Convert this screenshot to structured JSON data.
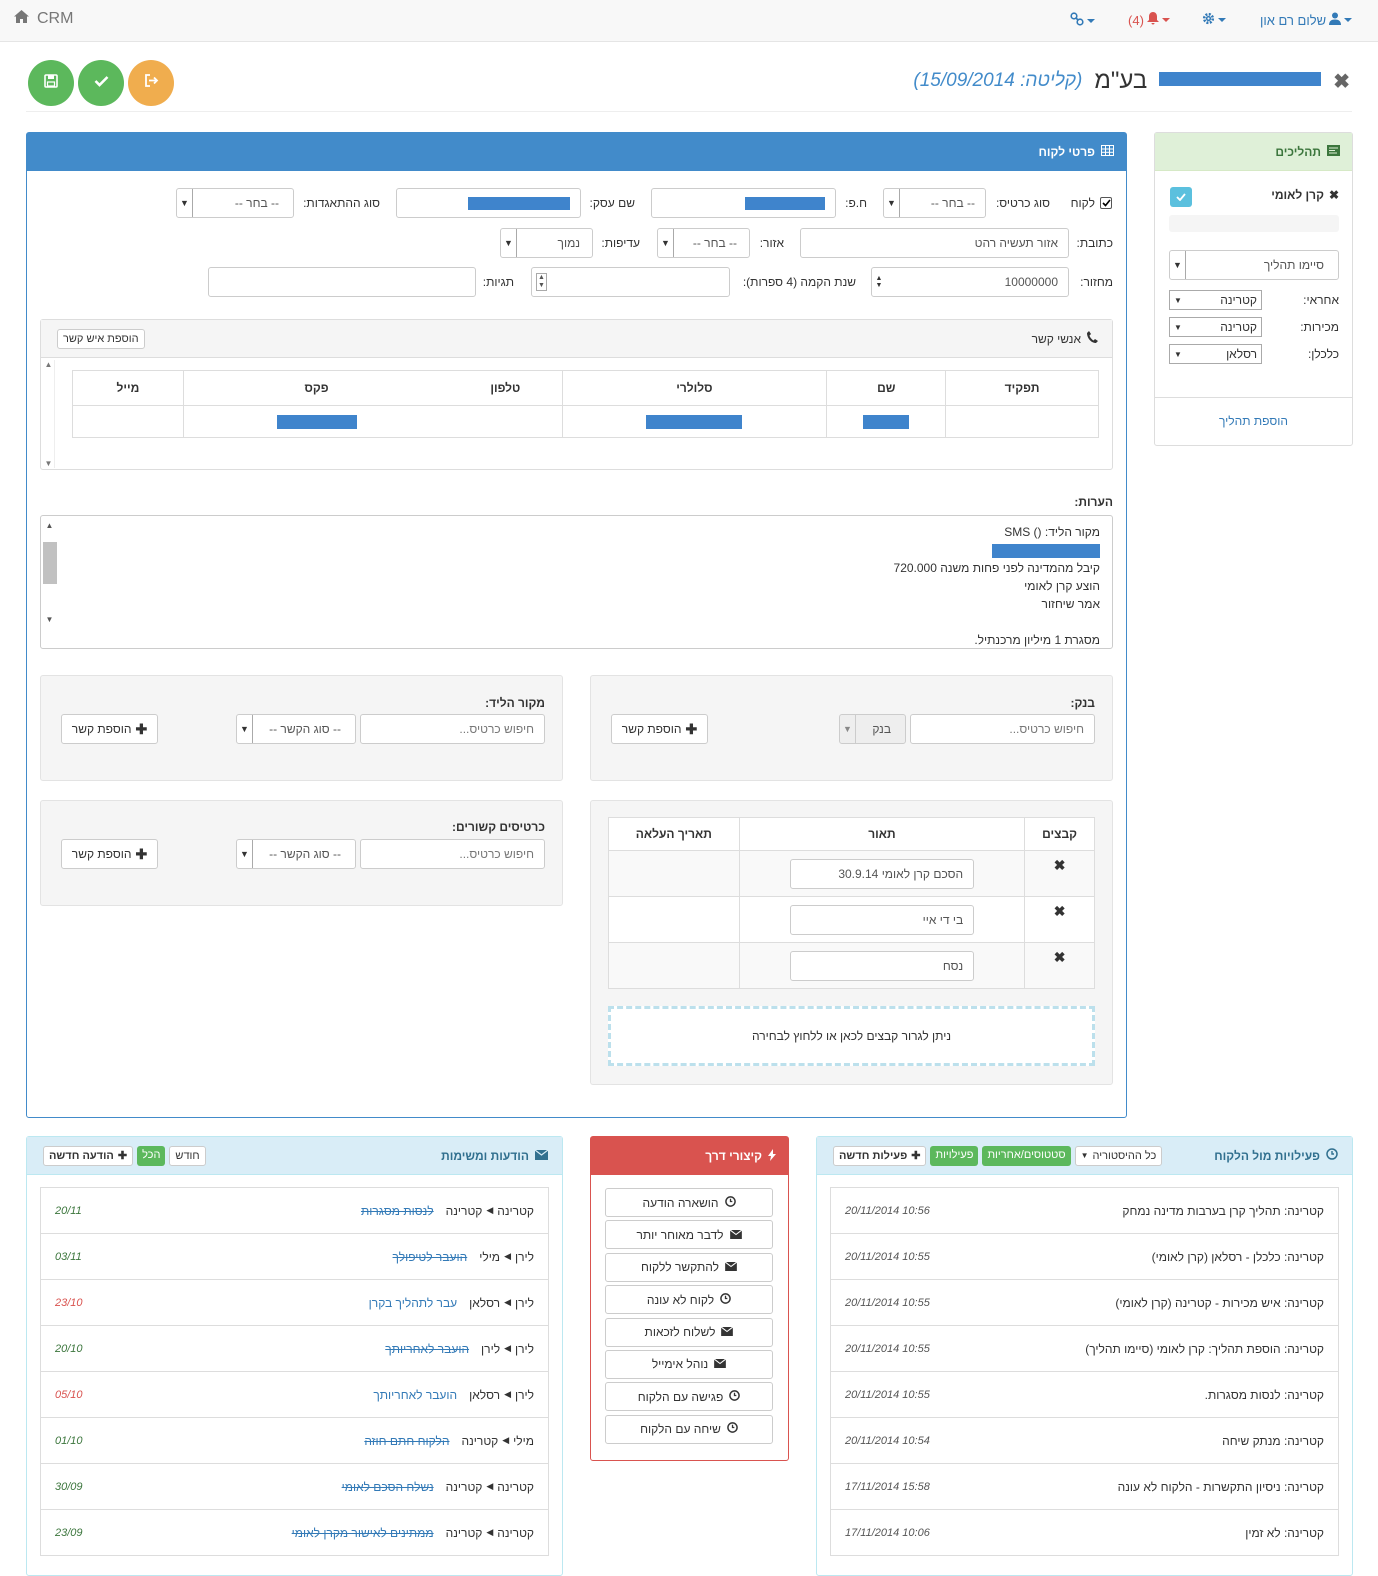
{
  "nav": {
    "brand": "CRM",
    "user": "שלום רם און",
    "alerts": "(4)"
  },
  "header": {
    "title_suffix": "בע\"מ",
    "intake_label": "(קליטה:",
    "intake_date": "15/09/2014)"
  },
  "customer": {
    "panel_title": "פרטי לקוח",
    "is_customer_label": "לקוח",
    "card_type_label": "סוג כרטיס:",
    "card_type_value": "-- בחר --",
    "hp_label": "ח.פ:",
    "business_name_label": "שם עסק:",
    "corp_type_label": "סוג ההתאגדות:",
    "corp_type_value": "-- בחר --",
    "address_label": "כתובת:",
    "address_value": "אזור תעשיה רהט",
    "area_label": "אזור:",
    "area_value": "-- בחר --",
    "priority_label": "עדיפות:",
    "priority_value": "נמוך",
    "turnover_label": "מחזור:",
    "turnover_value": "10000000",
    "founded_label": "שנת הקמה (4 ספרות):",
    "tags_label": "תגיות:"
  },
  "contacts": {
    "title": "אנשי קשר",
    "add_btn": "הוספת איש קשר",
    "columns": [
      "תפקיד",
      "שם",
      "סלולרי",
      "טלפון",
      "פקס",
      "מייל"
    ]
  },
  "notes": {
    "label": "הערות:",
    "lines": [
      "מקור הליד: () SMS",
      "קיבל מהמדינה לפני פחות משנה 720.000",
      "הוצע קרן לאומי",
      "אמר שיחזור",
      "מסגרת 1 מיליון מרכנתיל."
    ]
  },
  "bank": {
    "label": "בנק:",
    "search_placeholder": "חיפוש כרטיס...",
    "type_value": "בנק",
    "add_btn": "הוספת קשר"
  },
  "lead_source": {
    "label": "מקור הליד:",
    "search_placeholder": "חיפוש כרטיס...",
    "type_value": "-- סוג הקשר --",
    "add_btn": "הוספת קשר"
  },
  "related": {
    "label": "כרטיסים קשורים:",
    "search_placeholder": "חיפוש כרטיס...",
    "type_value": "-- סוג הקשר --",
    "add_btn": "הוספת קשר"
  },
  "files": {
    "columns": [
      "קבצים",
      "תאור",
      "תאריך העלאה"
    ],
    "rows": [
      "הסכם קרן לאומי  30.9.14",
      "בי די איי",
      "נסח"
    ],
    "dropzone": "ניתן לגרור קבצים לכאן או ללחוץ לבחירה"
  },
  "processes": {
    "title": "תהליכים",
    "item": "קרן לאומי",
    "stage": "סיימו תהליך",
    "resp_label": "אחראי:",
    "resp_value": "קטרינה",
    "sales_label": "מכירות:",
    "sales_value": "קטרינה",
    "econ_label": "כלכלן:",
    "econ_value": "רסלאן",
    "add_link": "הוספת תהליך"
  },
  "messages": {
    "title": "הודעות ומשימות",
    "new_btn": "הודעה חדשה",
    "all_btn": "הכל",
    "month_btn": "חודש",
    "items": [
      {
        "from": "קטרינה",
        "to": "קטרינה",
        "text": "לנסות מסגרות",
        "date": "20/11",
        "done": true,
        "late": false
      },
      {
        "from": "לירן",
        "to": "מילי",
        "text": "הועבר לטיפולך",
        "date": "03/11",
        "done": true,
        "late": false
      },
      {
        "from": "לירן",
        "to": "רסלאן",
        "text": "עבר לתהליך בקרן",
        "date": "23/10",
        "done": false,
        "late": true
      },
      {
        "from": "לירן",
        "to": "לירן",
        "text": "הועבר לאחריותך",
        "date": "20/10",
        "done": true,
        "late": false
      },
      {
        "from": "לירן",
        "to": "רסלאן",
        "text": "הועבר לאחריותך",
        "date": "05/10",
        "done": false,
        "late": true
      },
      {
        "from": "מילי",
        "to": "קטרינה",
        "text": "הלקוח חתם חוזה",
        "date": "01/10",
        "done": true,
        "late": false
      },
      {
        "from": "קטרינה",
        "to": "קטרינה",
        "text": "נשלח הסכם לאומי",
        "date": "30/09",
        "done": true,
        "late": false
      },
      {
        "from": "קטרינה",
        "to": "קטרינה",
        "text": "ממתינים לאישור מקרן לאומי",
        "date": "23/09",
        "done": true,
        "late": false
      }
    ]
  },
  "shortcuts": {
    "title": "קיצורי דרך",
    "items": [
      {
        "label": "הושארה הודעה",
        "icon": "clock-icon"
      },
      {
        "label": "לדבר מאוחר יותר",
        "icon": "envelope-icon"
      },
      {
        "label": "להתקשר ללקוח",
        "icon": "envelope-icon"
      },
      {
        "label": "לקוח לא עונה",
        "icon": "clock-icon"
      },
      {
        "label": "לשלוח לזכאות",
        "icon": "envelope-icon"
      },
      {
        "label": "נוהל אימייל",
        "icon": "envelope-icon"
      },
      {
        "label": "פגישה עם הלקוח",
        "icon": "clock-icon"
      },
      {
        "label": "שיחה עם הלקוח",
        "icon": "clock-icon"
      }
    ]
  },
  "activities": {
    "title": "פעילויות מול הלקוח",
    "history_btn": "כל ההיסטוריה",
    "status_btn": "סטטוסים/אחריות",
    "act_btn": "פעילויות",
    "new_btn": "פעילות חדשה",
    "items": [
      {
        "text": "קטרינה: תהליך קרן בערבות מדינה נמחק",
        "date": "20/11/2014 10:56"
      },
      {
        "text": "קטרינה: כלכלן - רסלאן (קרן לאומי)",
        "date": "20/11/2014 10:55"
      },
      {
        "text": "קטרינה: איש מכירות - קטרינה (קרן לאומי)",
        "date": "20/11/2014 10:55"
      },
      {
        "text": "קטרינה: הוספת תהליך: קרן לאומי (סיימו תהליך)",
        "date": "20/11/2014 10:55"
      },
      {
        "text": "קטרינה: לנסות מסגרות.",
        "date": "20/11/2014 10:55"
      },
      {
        "text": "קטרינה: מנתק שיחה",
        "date": "20/11/2014 10:54"
      },
      {
        "text": "קטרינה: ניסיון התקשרות - הלקוח לא עונה",
        "date": "17/11/2014 15:58"
      },
      {
        "text": "קטרינה: לא זמין",
        "date": "17/11/2014 10:06"
      }
    ]
  },
  "colors": {
    "primary": "#428bca",
    "success": "#5cb85c",
    "warning": "#f0ad4e",
    "danger": "#d9534f"
  }
}
